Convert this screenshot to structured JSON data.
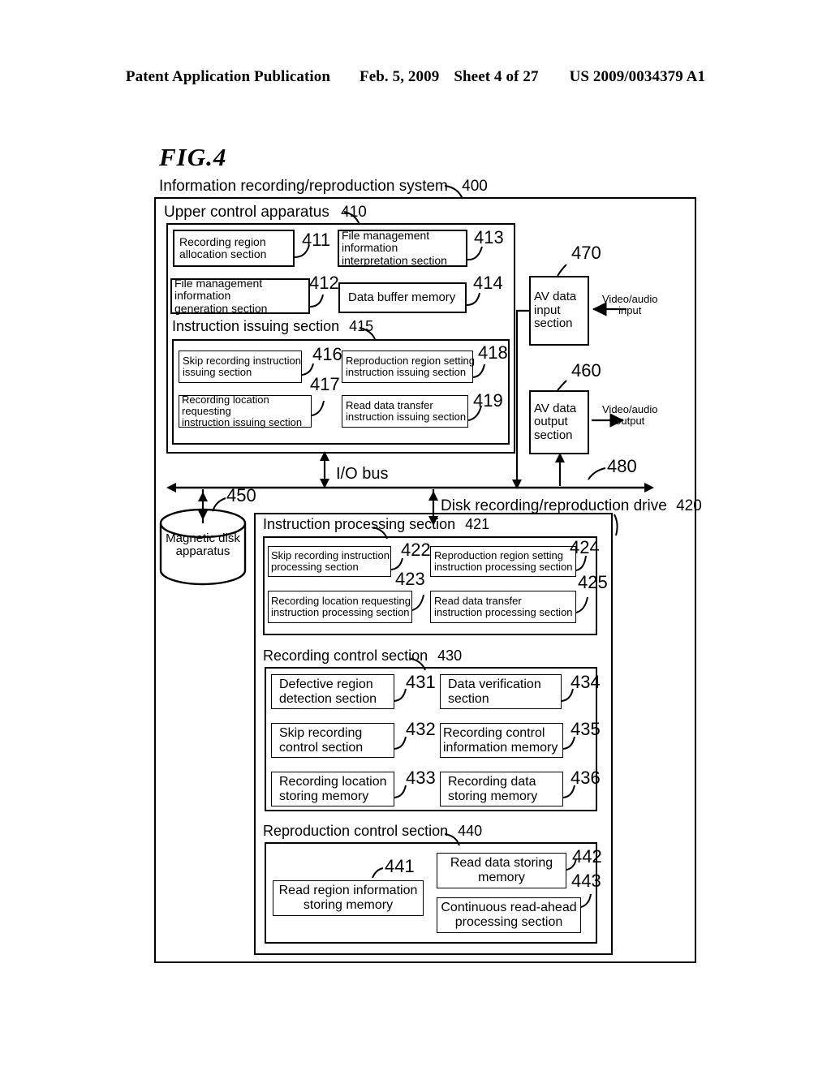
{
  "header": {
    "publication": "Patent Application Publication",
    "date": "Feb. 5, 2009",
    "sheet": "Sheet 4 of 27",
    "docnum": "US 2009/0034379 A1"
  },
  "figure": {
    "label": "FIG.4",
    "system_title": "Information recording/reproduction system",
    "system_num": "400"
  },
  "upper": {
    "title": "Upper control apparatus",
    "num": "410",
    "blocks": [
      {
        "label": "Recording region\nallocation section",
        "num": "411"
      },
      {
        "label": "File management information\ninterpretation section",
        "num": "413"
      },
      {
        "label": "File management information\ngeneration section",
        "num": "412"
      },
      {
        "label": "Data buffer memory",
        "num": "414"
      }
    ],
    "instruction": {
      "title": "Instruction issuing section",
      "num": "415",
      "blocks": [
        {
          "label": "Skip recording instruction\nissuing section",
          "num": "416"
        },
        {
          "label": "Reproduction region setting\ninstruction issuing section",
          "num": "418"
        },
        {
          "label": "Recording location requesting\ninstruction issuing section",
          "num": "417"
        },
        {
          "label": "Read data transfer\ninstruction issuing section",
          "num": "419"
        }
      ]
    }
  },
  "av": {
    "input": {
      "label": "AV data\ninput\nsection",
      "num": "470",
      "io": "Video/audio\ninput"
    },
    "output": {
      "label": "AV data\noutput\nsection",
      "num": "460",
      "io": "Video/audio\noutput"
    }
  },
  "bus": {
    "label": "I/O bus",
    "num": "480"
  },
  "disk": {
    "label": "Magnetic disk\napparatus",
    "num": "450"
  },
  "drive": {
    "title": "Disk recording/reproduction drive",
    "num": "420",
    "instruction_processing": {
      "title": "Instruction processing section",
      "num": "421",
      "blocks": [
        {
          "label": "Skip recording instruction\nprocessing section",
          "num": "422"
        },
        {
          "label": "Reproduction region setting\ninstruction processing section",
          "num": "424"
        },
        {
          "label": "Recording location requesting\ninstruction processing section",
          "num": "423"
        },
        {
          "label": "Read data transfer\ninstruction processing section",
          "num": "425"
        }
      ]
    },
    "recording_control": {
      "title": "Recording control section",
      "num": "430",
      "blocks": [
        {
          "label": "Defective region\ndetection section",
          "num": "431"
        },
        {
          "label": "Data verification\nsection",
          "num": "434"
        },
        {
          "label": "Skip recording\ncontrol section",
          "num": "432"
        },
        {
          "label": "Recording control\ninformation memory",
          "num": "435"
        },
        {
          "label": "Recording location\nstoring memory",
          "num": "433"
        },
        {
          "label": "Recording data\nstoring memory",
          "num": "436"
        }
      ]
    },
    "reproduction_control": {
      "title": "Reproduction control section",
      "num": "440",
      "blocks": [
        {
          "label": "Read region information\nstoring memory",
          "num": "441"
        },
        {
          "label": "Read data storing\nmemory",
          "num": "442"
        },
        {
          "label": "Continuous read-ahead\nprocessing section",
          "num": "443"
        }
      ]
    }
  }
}
